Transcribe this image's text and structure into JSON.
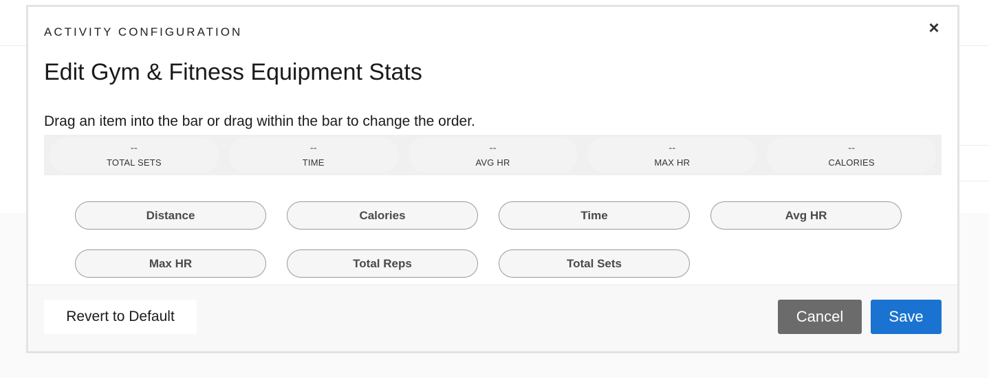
{
  "modal": {
    "eyebrow": "ACTIVITY CONFIGURATION",
    "title": "Edit Gym & Fitness Equipment Stats",
    "instruction": "Drag an item into the bar or drag within the bar to change the order.",
    "close_icon": "close-icon",
    "close_glyph": "×"
  },
  "stat_bar": {
    "slots": [
      {
        "value": "--",
        "label": "TOTAL SETS"
      },
      {
        "value": "--",
        "label": "TIME"
      },
      {
        "value": "--",
        "label": "AVG HR"
      },
      {
        "value": "--",
        "label": "MAX HR"
      },
      {
        "value": "--",
        "label": "CALORIES"
      }
    ]
  },
  "available_stats": [
    "Distance",
    "Calories",
    "Time",
    "Avg HR",
    "Max HR",
    "Total Reps",
    "Total Sets"
  ],
  "footer": {
    "revert_label": "Revert to Default",
    "cancel_label": "Cancel",
    "save_label": "Save"
  },
  "colors": {
    "save": "#1a73d0",
    "cancel": "#6b6b6b"
  }
}
